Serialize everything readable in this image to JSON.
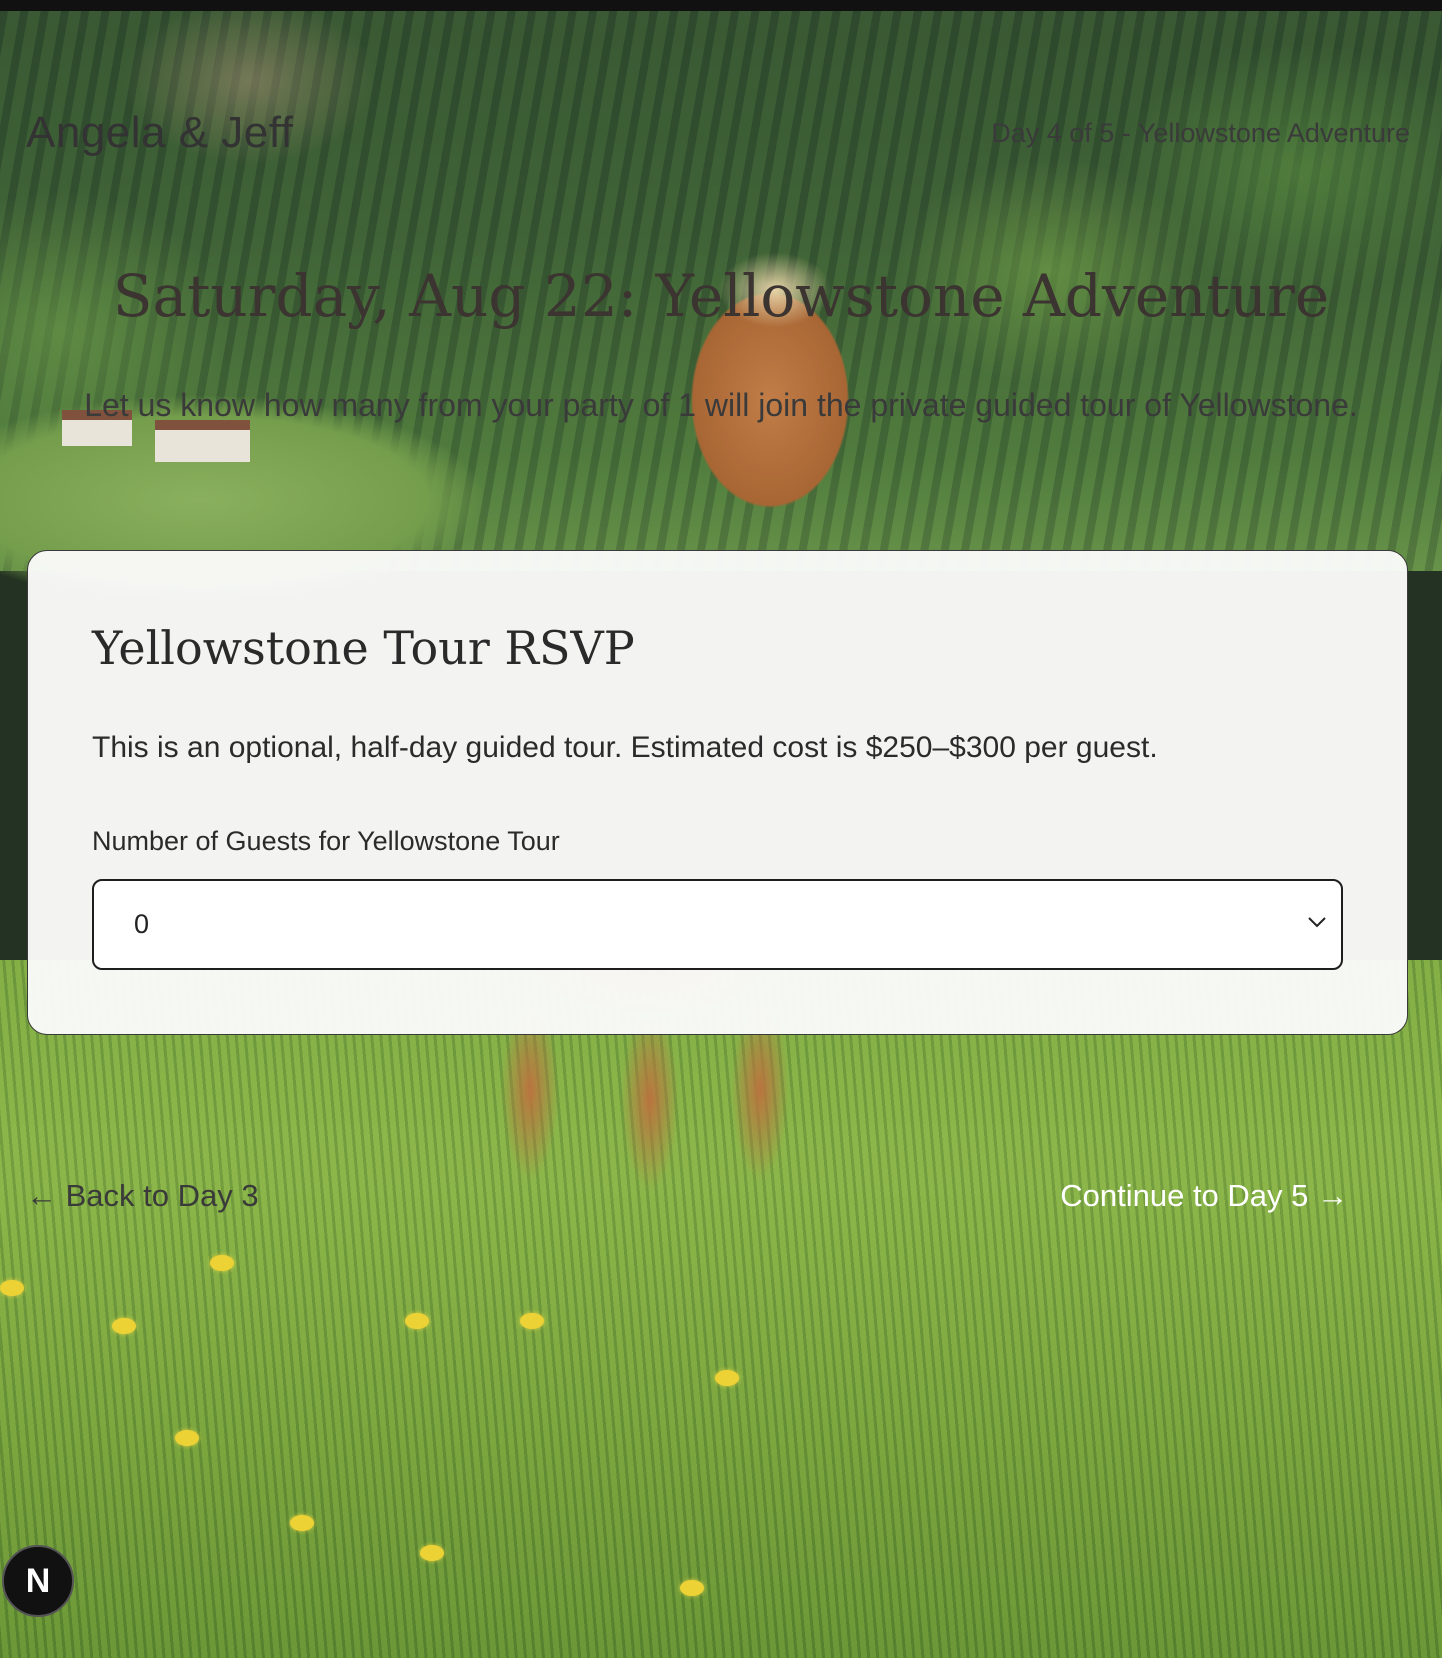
{
  "header": {
    "brand": "Angela & Jeff",
    "day_indicator": "Day 4 of 5 - Yellowstone Adventure"
  },
  "hero": {
    "title": "Saturday, Aug 22: Yellowstone Adventure",
    "subtitle": "Let us know how many from your party of 1 will join the private guided tour of Yellowstone."
  },
  "rsvp_card": {
    "title": "Yellowstone Tour RSVP",
    "description": "This is an optional, half-day guided tour. Estimated cost is $250–$300 per guest.",
    "field_label": "Number of Guests for Yellowstone Tour",
    "selected_value": "0",
    "icon": "chevron-down-icon"
  },
  "nav": {
    "back_label": "← Back to Day 3",
    "next_label": "Continue to Day 5 →"
  },
  "badge": {
    "label": "N"
  },
  "colors": {
    "card_background": "#fafaf9",
    "card_border": "#3a3a3a",
    "next_link": "#ffffff",
    "text_dark": "#2b2b2b"
  }
}
